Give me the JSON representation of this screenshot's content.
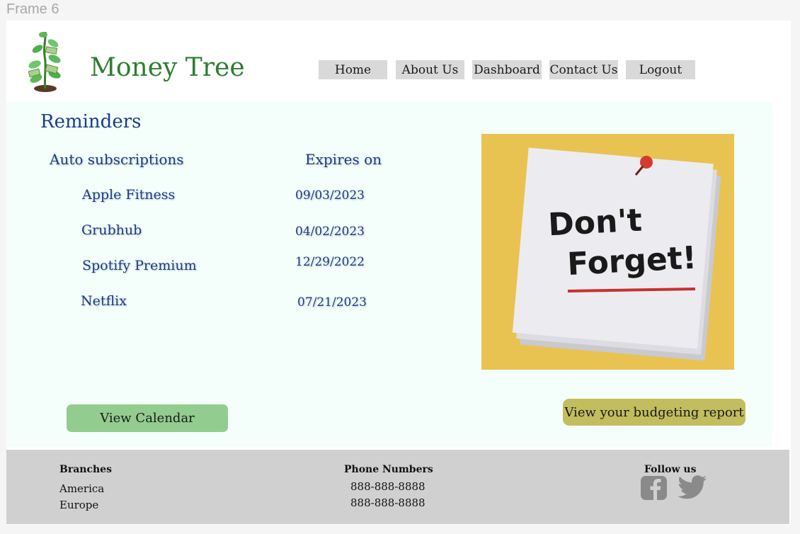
{
  "frame_label": "Frame 6",
  "brand": {
    "name": "Money Tree"
  },
  "nav": {
    "home": "Home",
    "about": "About Us",
    "dashboard": "Dashboard",
    "contact": "Contact Us",
    "logout": "Logout"
  },
  "reminders": {
    "title": "Reminders",
    "col_subscriptions": "Auto subscriptions",
    "col_expires": "Expires on",
    "rows": [
      {
        "name": "Apple Fitness",
        "date": "09/03/2023"
      },
      {
        "name": "Grubhub",
        "date": "04/02/2023"
      },
      {
        "name": "Spotify Premium",
        "date": "12/29/2022"
      },
      {
        "name": "Netflix",
        "date": "07/21/2023"
      }
    ]
  },
  "image": {
    "note_line1": "Don't",
    "note_line2": "Forget!"
  },
  "buttons": {
    "calendar": "View Calendar",
    "report": "View your budgeting report"
  },
  "footer": {
    "branches_title": "Branches",
    "branches": [
      "America",
      "Europe"
    ],
    "phones_title": "Phone Numbers",
    "phones": [
      "888-888-8888",
      "888-888-8888"
    ],
    "follow_title": "Follow us"
  },
  "colors": {
    "brand_green": "#2e7d32",
    "heading_blue": "#1a3c8a",
    "calendar_button": "#93cc8f",
    "report_button": "#c2bd5e",
    "nav_bg": "#d9d9d9",
    "footer_bg": "#d0d0d0"
  },
  "icons": [
    "money-tree-logo",
    "facebook-icon",
    "twitter-icon"
  ]
}
